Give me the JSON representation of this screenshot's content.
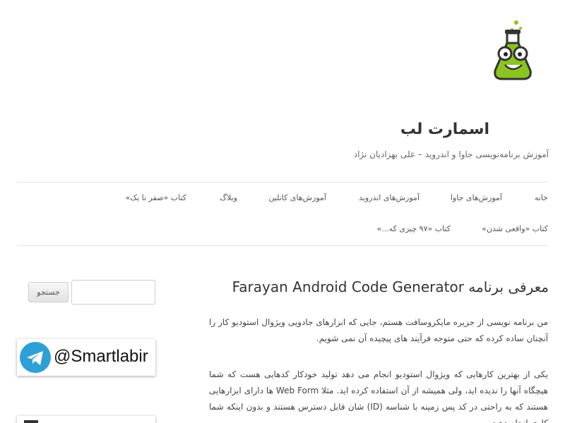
{
  "site": {
    "title": "اسمارت لب",
    "description": "آموزش برنامه‌نویسی جاوا و اندروید – علی بهزادیان نژاد"
  },
  "nav": {
    "items": [
      {
        "label": "خانه"
      },
      {
        "label": "آموزش‌های جاوا"
      },
      {
        "label": "آموزش‌های اندروید"
      },
      {
        "label": "آموزش‌های کاتلین"
      },
      {
        "label": "وبلاگ"
      },
      {
        "label": "کتاب «صفر تا یک»"
      },
      {
        "label": "کتاب «واقعی شدن»"
      },
      {
        "label": "کتاب «۹۷ چیزی که...»"
      }
    ]
  },
  "post": {
    "title": "معرفی برنامه Farayan Android Code Generator",
    "paragraphs": [
      "من برنامه نویسی از جزیره مایکروسافت هستم، جایی که ابزارهای جادویی ویژوال استودیو کار را آنچنان ساده کرده که حتی متوجه فرآیند های پیچیده آن نمی شویم.",
      "یکی از بهترین کارهایی که ویژوال استودیو انجام می دهد تولید خودکار کدهایی هست که شما هیچگاه آنها را ندیده اید، ولی همیشه از آن استفاده کرده اید. مثلا Web Form ها دارای ابزارهایی هستند که به راحتی در کد پس زمینه با شناسه (ID) شان قابل دسترس هستند و بدون اینکه شما کاری انجام دهید"
    ]
  },
  "sidebar": {
    "search": {
      "placeholder": "",
      "button_label": "جستجو"
    },
    "telegram": {
      "handle": "@Smartlabir"
    }
  },
  "colors": {
    "logo_green": "#8bc420",
    "telegram_blue": "#2f9fd8",
    "divider": "#e5e5e5"
  }
}
